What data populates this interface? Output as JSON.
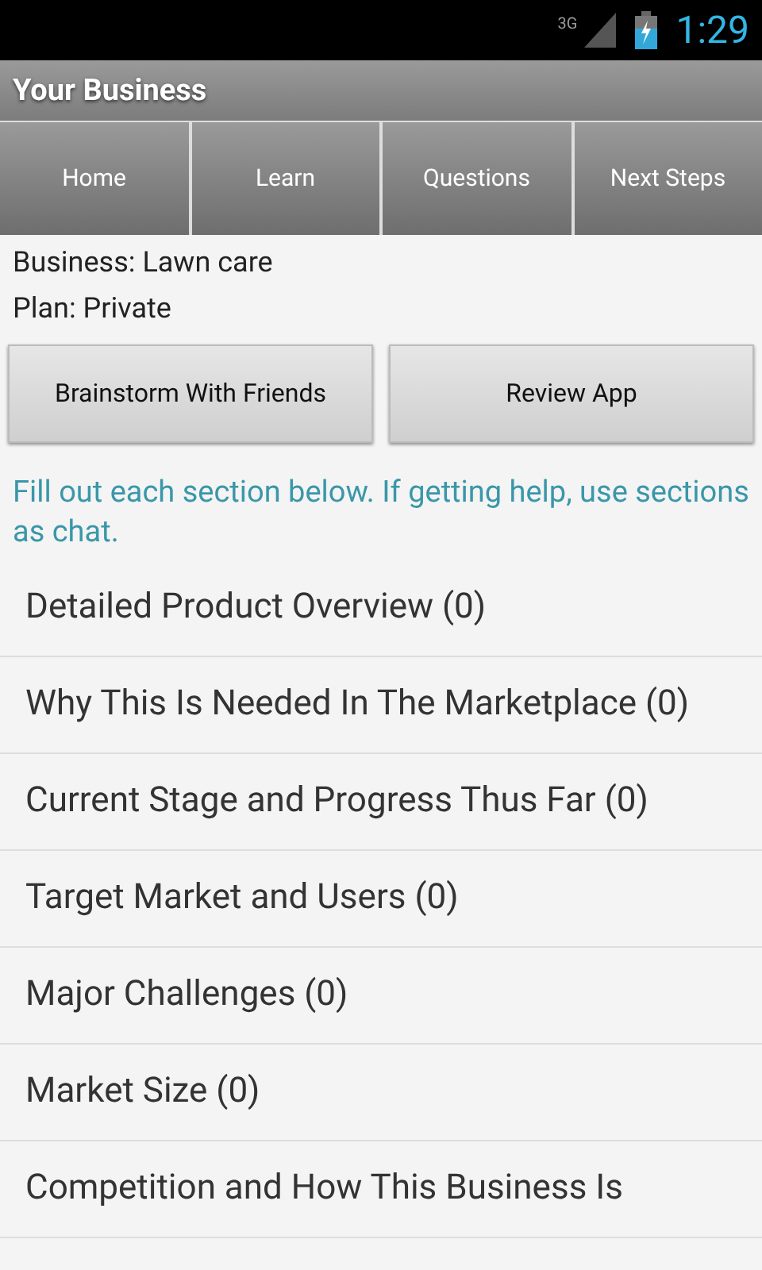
{
  "status_bar": {
    "network": "3G",
    "time": "1:29"
  },
  "title_bar": {
    "title": "Your Business"
  },
  "tabs": [
    {
      "label": "Home"
    },
    {
      "label": "Learn"
    },
    {
      "label": "Questions"
    },
    {
      "label": "Next Steps"
    }
  ],
  "info": [
    "Business: Lawn care",
    "Plan: Private"
  ],
  "buttons": [
    "Brainstorm With Friends",
    "Review App"
  ],
  "hint": "Fill out each section below. If getting help, use sections as chat.",
  "sections": [
    "Detailed Product Overview (0)",
    "Why This Is Needed In The Marketplace (0)",
    "Current Stage and Progress Thus Far (0)",
    "Target Market and Users (0)",
    "Major Challenges (0)",
    "Market Size (0)",
    "Competition and How This Business Is"
  ]
}
